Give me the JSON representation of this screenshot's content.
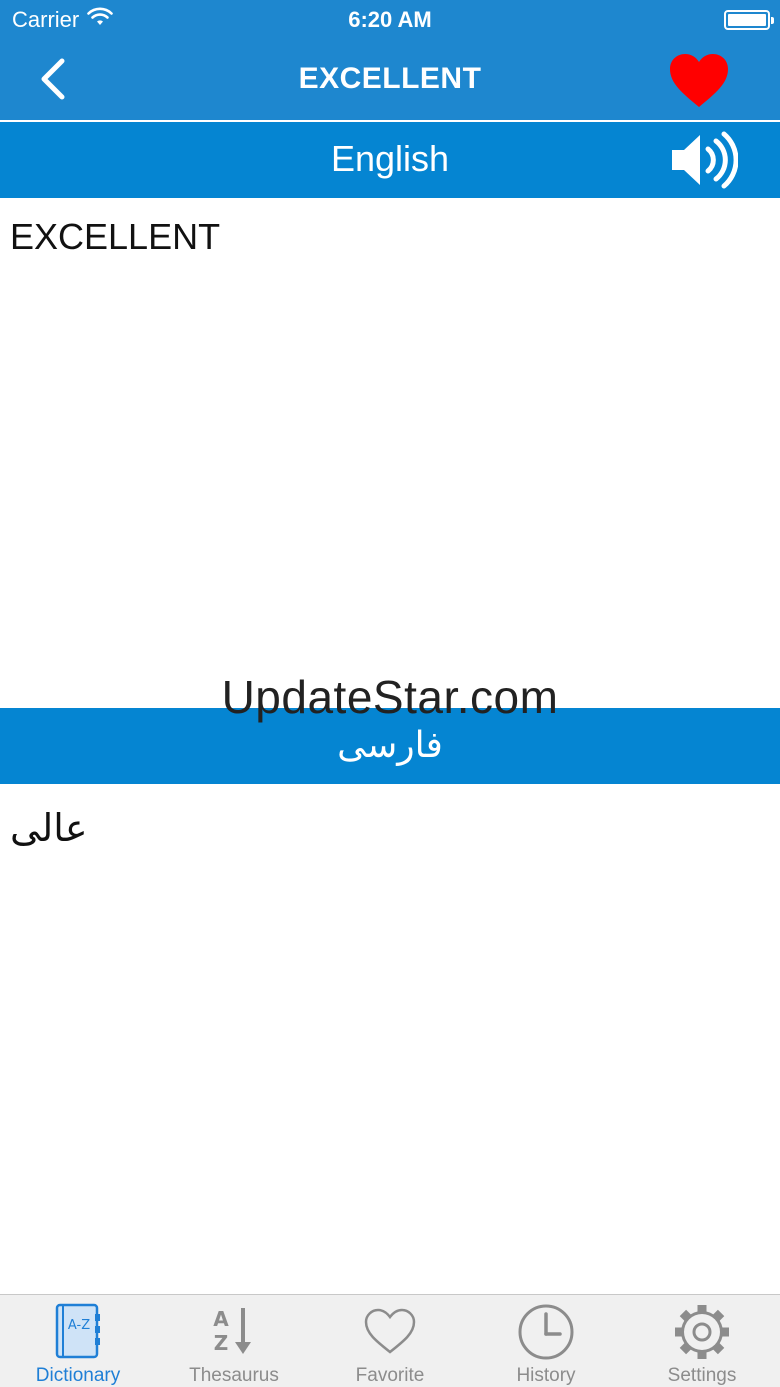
{
  "status_bar": {
    "carrier": "Carrier",
    "time": "6:20 AM"
  },
  "nav": {
    "title": "EXCELLENT",
    "back_icon": "chevron-left-icon",
    "favorite_icon": "heart-icon",
    "favorite_color": "#ff0000"
  },
  "english_section": {
    "header": "English",
    "speaker_icon": "speaker-icon",
    "word": "EXCELLENT"
  },
  "persian_section": {
    "header": "فارسی",
    "translation": "عالی"
  },
  "watermark": "UpdateStar.com",
  "tabs": [
    {
      "label": "Dictionary",
      "icon": "dictionary-book-icon",
      "active": true
    },
    {
      "label": "Thesaurus",
      "icon": "az-sort-icon",
      "active": false
    },
    {
      "label": "Favorite",
      "icon": "heart-outline-icon",
      "active": false
    },
    {
      "label": "History",
      "icon": "clock-icon",
      "active": false
    },
    {
      "label": "Settings",
      "icon": "gear-icon",
      "active": false
    }
  ],
  "colors": {
    "nav_bg": "#1e87cf",
    "lang_bar_bg": "#0585d2",
    "active_tab": "#1f7fd6",
    "inactive_tab": "#8c8c8c"
  }
}
